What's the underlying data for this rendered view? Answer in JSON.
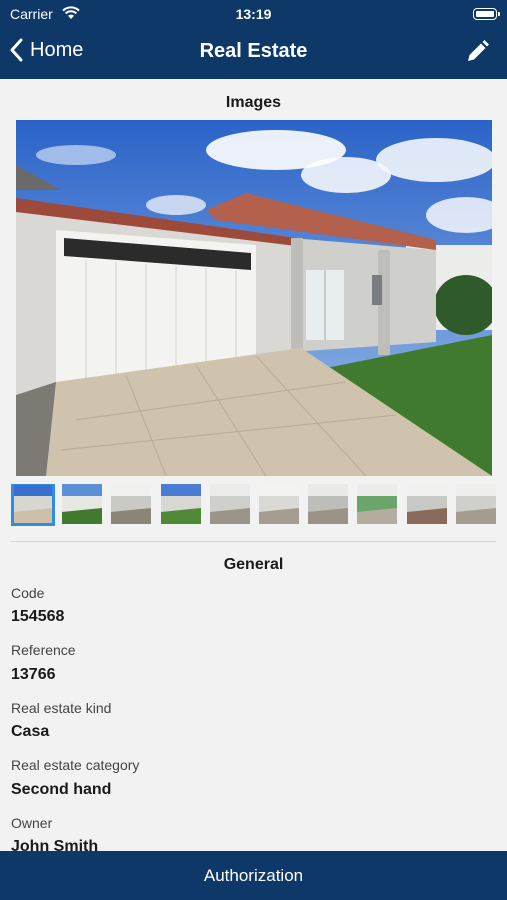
{
  "status_bar": {
    "carrier": "Carrier",
    "time": "13:19"
  },
  "nav": {
    "back_label": "Home",
    "title": "Real Estate"
  },
  "images": {
    "section_title": "Images",
    "thumbnail_count": 10,
    "selected_index": 0
  },
  "general": {
    "section_title": "General",
    "fields": [
      {
        "label": "Code",
        "value": "154568"
      },
      {
        "label": "Reference",
        "value": "13766"
      },
      {
        "label": "Real estate kind",
        "value": "Casa"
      },
      {
        "label": "Real estate category",
        "value": "Second hand"
      },
      {
        "label": "Owner",
        "value": "John Smith"
      }
    ]
  },
  "bottom_button": {
    "label": "Authorization"
  },
  "colors": {
    "nav_bar": "#0d3868",
    "thumbnail_selected": "#2f8de4"
  }
}
